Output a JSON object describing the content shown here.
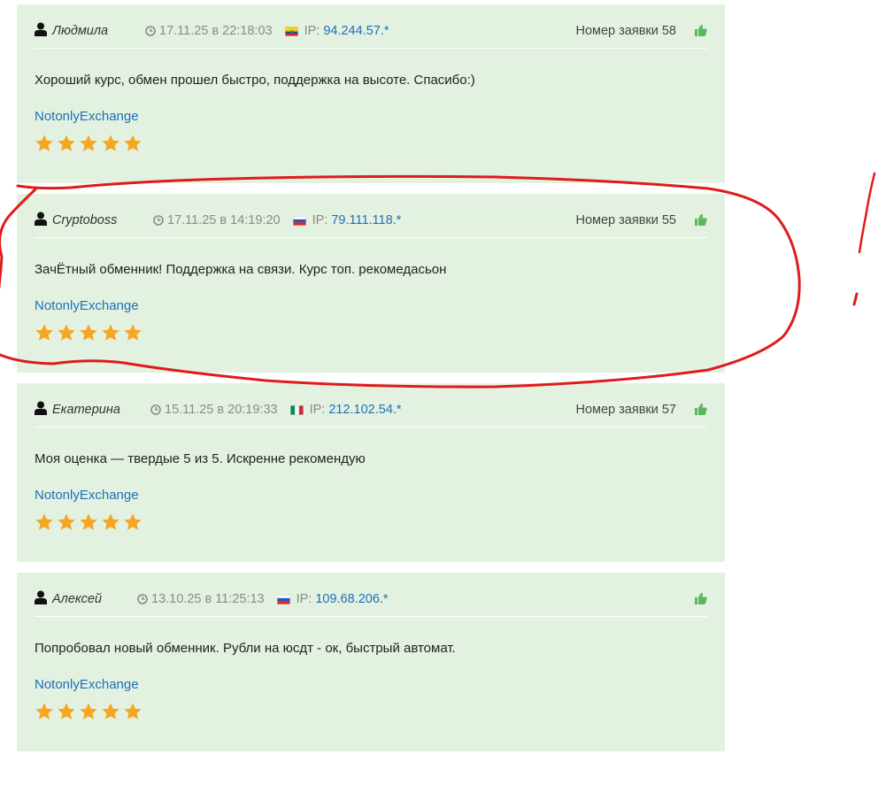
{
  "colors": {
    "card_bg": "#e3f2e0",
    "link": "#1e6fb8",
    "star": "#f5a623",
    "like": "#5cb85c",
    "annotation": "#e01b1b"
  },
  "reviews": [
    {
      "author": "Людмила",
      "date": "17.11.25 в 22:18:03",
      "flag": "ecuador-flag-icon",
      "ip_label": "IP:",
      "ip": "94.244.57.*",
      "order": "Номер заявки 58",
      "text": "Хороший курс, обмен прошел быстро, поддержка на высоте. Спасибо:)",
      "site": "NotonlyExchange",
      "rating": 5
    },
    {
      "author": "Cryptoboss",
      "date": "17.11.25 в 14:19:20",
      "flag": "russia-flag-icon",
      "ip_label": "IP:",
      "ip": "79.111.118.*",
      "order": "Номер заявки 55",
      "text": "ЗачЁтный обменник! Поддержка на связи. Курс топ. рекомедасьон",
      "site": "NotonlyExchange",
      "rating": 5
    },
    {
      "author": "Екатерина",
      "date": "15.11.25 в 20:19:33",
      "flag": "italy-flag-icon",
      "ip_label": "IP:",
      "ip": "212.102.54.*",
      "order": "Номер заявки 57",
      "text": "Моя оценка — твердые 5 из 5. Искренне рекомендую",
      "site": "NotonlyExchange",
      "rating": 5
    },
    {
      "author": "Алексей",
      "date": "13.10.25 в 11:25:13",
      "flag": "russia-flag-icon",
      "ip_label": "IP:",
      "ip": "109.68.206.*",
      "order": "",
      "text": "Попробовал новый обменник. Рубли на юсдт - ок, быстрый автомат.",
      "site": "NotonlyExchange",
      "rating": 5
    }
  ],
  "annotation": {
    "shape": "freehand-ellipse",
    "highlighted_review": 2,
    "mark": "!"
  }
}
